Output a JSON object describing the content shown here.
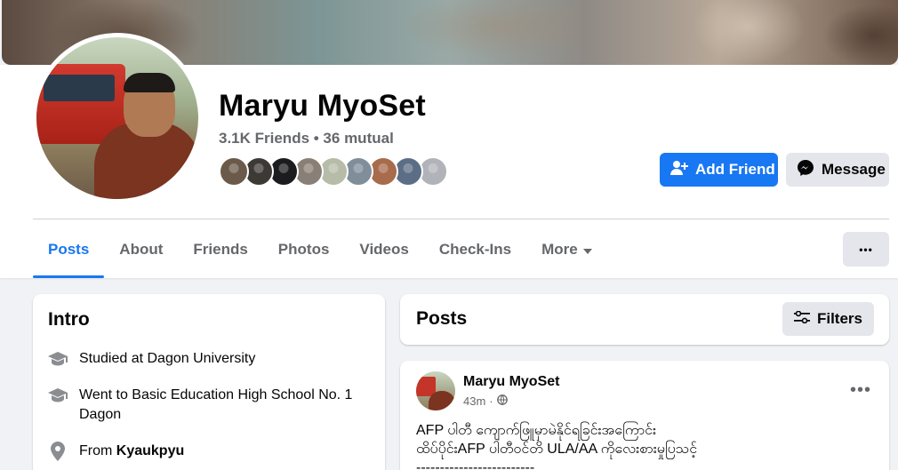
{
  "profile": {
    "name": "Maryu MyoSet",
    "friends_line": "3.1K Friends • 36 mutual",
    "mutual_avatar_colors": [
      "#6b5a4a",
      "#3d3a36",
      "#1c1c1e",
      "#8a7f76",
      "#b7bca8",
      "#7f8e98",
      "#a86b4c",
      "#5b6e85",
      "#b0b3b8"
    ]
  },
  "actions": {
    "add_friend": "Add Friend",
    "message": "Message",
    "more": "•••"
  },
  "tabs": [
    {
      "label": "Posts",
      "active": true
    },
    {
      "label": "About"
    },
    {
      "label": "Friends"
    },
    {
      "label": "Photos"
    },
    {
      "label": "Videos"
    },
    {
      "label": "Check-Ins"
    },
    {
      "label": "More"
    }
  ],
  "intro": {
    "title": "Intro",
    "items": [
      {
        "icon": "graduation-cap-icon",
        "text": "Studied at Dagon University"
      },
      {
        "icon": "graduation-cap-icon",
        "text": "Went to Basic Education High School No. 1 Dagon"
      },
      {
        "icon": "location-pin-icon",
        "prefix": "From ",
        "bold": "Kyaukpyu"
      }
    ]
  },
  "posts_header": {
    "title": "Posts",
    "filters": "Filters"
  },
  "post": {
    "author": "Maryu MyoSet",
    "time": "43m",
    "separator": "·",
    "lines": [
      "AFP ပါတီ ကျောက်ဖြူမှာမဲနိုင်ရခြင်းအကြောင်း",
      "ထိပ်ပိုင်းAFP ပါတီဝင်တိ ULA/AA ကိုလေးစားမှုပြသင့်",
      "-------------------------"
    ]
  },
  "colors": {
    "accent": "#1877f2",
    "secondary_button": "#e4e6eb",
    "muted_text": "#65676b",
    "page_bg": "#f0f2f5"
  }
}
